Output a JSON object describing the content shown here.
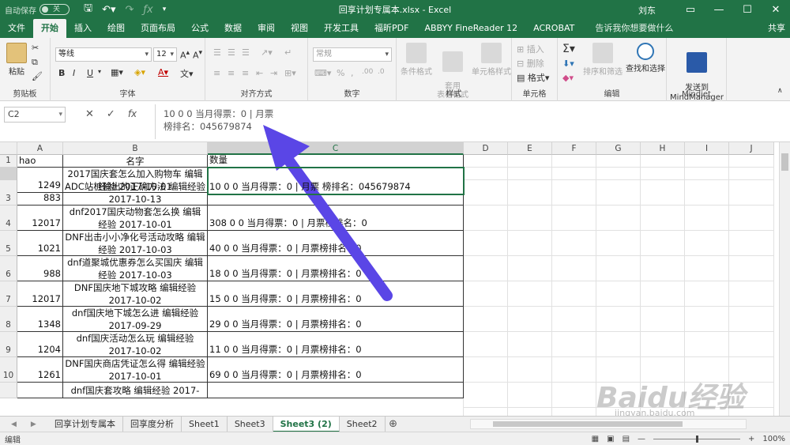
{
  "titlebar": {
    "autosave_label": "自动保存",
    "autosave_state": "关",
    "doc_title": "回享计划专属本.xlsx  -  Excel",
    "user": "刘东"
  },
  "tabs": [
    "文件",
    "开始",
    "插入",
    "绘图",
    "页面布局",
    "公式",
    "数据",
    "审阅",
    "视图",
    "开发工具",
    "福昕PDF",
    "ABBYY FineReader 12",
    "ACROBAT",
    "告诉我你想要做什么"
  ],
  "active_tab": "开始",
  "share_label": "共享",
  "ribbon": {
    "paste_label": "粘贴",
    "clipboard_label": "剪贴板",
    "font_name": "等线",
    "font_size": "12",
    "font_label": "字体",
    "align_label": "对齐方式",
    "number_format": "常规",
    "number_label": "数字",
    "cond_format_label": "条件格式",
    "table_format_label": "套用\n表格格式",
    "cell_style_label": "单元格样式",
    "style_label": "样式",
    "insert_label": "插入",
    "delete_label": "删除",
    "format_label": "格式",
    "cells_label": "单元格",
    "sort_label": "排序和筛选",
    "find_label": "查找和选择",
    "edit_label": "编辑",
    "mindmanager_label": "发送到\nMindManager",
    "mindjet_label": "Mindjet",
    "bold": "B",
    "italic": "I",
    "underline": "U"
  },
  "formula_bar": {
    "name_box": "C2",
    "line1": "10 0 0 当月得票：0 | 月票",
    "line2": "榜排名：045679874"
  },
  "columns": [
    "A",
    "B",
    "C",
    "D",
    "E",
    "F",
    "G",
    "H",
    "I",
    "J"
  ],
  "rows": [
    {
      "num": "1",
      "a": "hao",
      "b": "名字",
      "c": "数量"
    },
    {
      "num": "2",
      "a": "1249",
      "b": "2017国庆套怎么加入购物车 编辑经验 2017-10-01",
      "c": "10 0 0 当月得票：0 | 月票 榜排名：045679874"
    },
    {
      "num": "3",
      "a": "883",
      "b": "ADC站桩输出的正确方法 编辑经验 2017-10-13",
      "c": ""
    },
    {
      "num": "4",
      "a": "12017",
      "b": "dnf2017国庆动物套怎么换 编辑经验 2017-10-01",
      "c": "308 0 0 当月得票：0 | 月票榜排名：0"
    },
    {
      "num": "5",
      "a": "1021",
      "b": "DNF出击小小净化号活动攻略 编辑经验 2017-10-03",
      "c": "40 0 0 当月得票：0 | 月票榜排名：0"
    },
    {
      "num": "6",
      "a": "988",
      "b": "dnf道聚城优惠券怎么买国庆 编辑经验 2017-10-03",
      "c": "18 0 0 当月得票：0 | 月票榜排名：0"
    },
    {
      "num": "7",
      "a": "12017",
      "b": "DNF国庆地下城攻略 编辑经验 2017-10-02",
      "c": "15 0 0 当月得票：0 | 月票榜排名：0"
    },
    {
      "num": "8",
      "a": "1348",
      "b": "dnf国庆地下城怎么进 编辑经验 2017-09-29",
      "c": "29 0 0 当月得票：0 | 月票榜排名：0"
    },
    {
      "num": "9",
      "a": "1204",
      "b": "dnf国庆活动怎么玩 编辑经验 2017-10-02",
      "c": "11 0 0 当月得票：0 | 月票榜排名：0"
    },
    {
      "num": "10",
      "a": "1261",
      "b": "DNF国庆商店凭证怎么得 编辑经验 2017-10-01",
      "c": "69 0 0 当月得票：0 | 月票榜排名：0"
    },
    {
      "num": "",
      "a": "",
      "b": "dnf国庆套攻略 编辑经验 2017-",
      "c": ""
    }
  ],
  "sheets": [
    "回享计划专属本",
    "回享度分析",
    "Sheet1",
    "Sheet3",
    "Sheet3 (2)",
    "Sheet2"
  ],
  "active_sheet": "Sheet3 (2)",
  "status": {
    "mode": "编辑",
    "zoom": "100%"
  },
  "watermark": {
    "logo": "Baidu经验",
    "url": "jingyan.baidu.com"
  },
  "colors": {
    "excel_green": "#217346",
    "annotation_arrow": "#5a46e6"
  }
}
